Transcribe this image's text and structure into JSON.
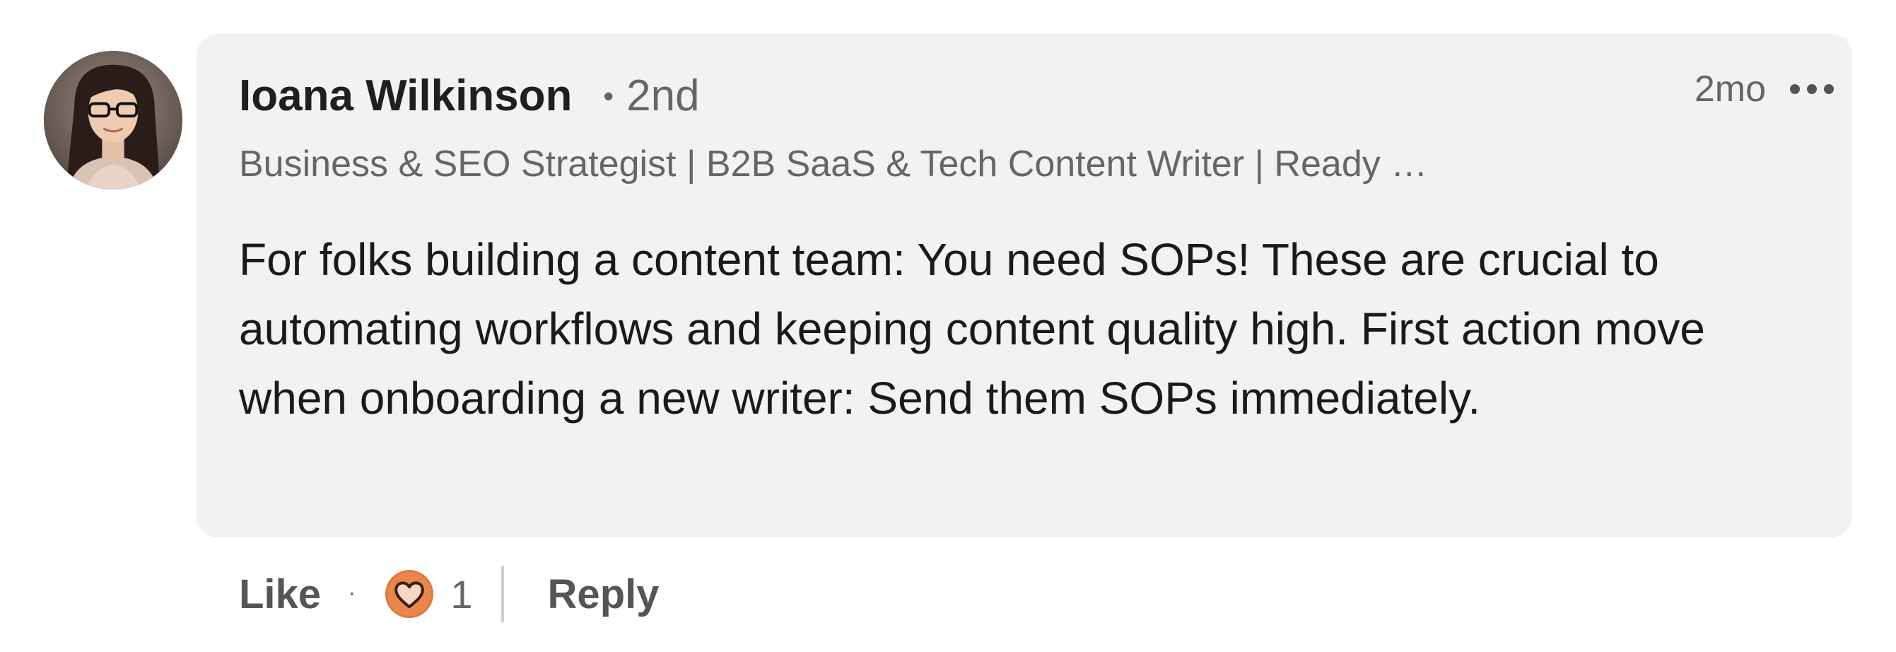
{
  "comment": {
    "author": {
      "name": "Ioana Wilkinson",
      "connection_degree": "2nd",
      "headline": "Business & SEO Strategist | B2B SaaS & Tech Content Writer | Ready …"
    },
    "timestamp": "2mo",
    "text": "For folks building a content team: You need SOPs! These are crucial to automating workflows and keeping content quality high. First action move when onboarding a new writer: Send them SOPs immediately.",
    "separator": "•"
  },
  "actions": {
    "like_label": "Like",
    "separator": "·",
    "reaction_count": "1",
    "reply_label": "Reply"
  },
  "icons": {
    "more": "more-horizontal-icon",
    "reaction": "love-reaction-icon"
  },
  "colors": {
    "bubble_bg": "#f2f2f2",
    "reaction_orange": "#e0793e",
    "muted_text": "#666666"
  }
}
